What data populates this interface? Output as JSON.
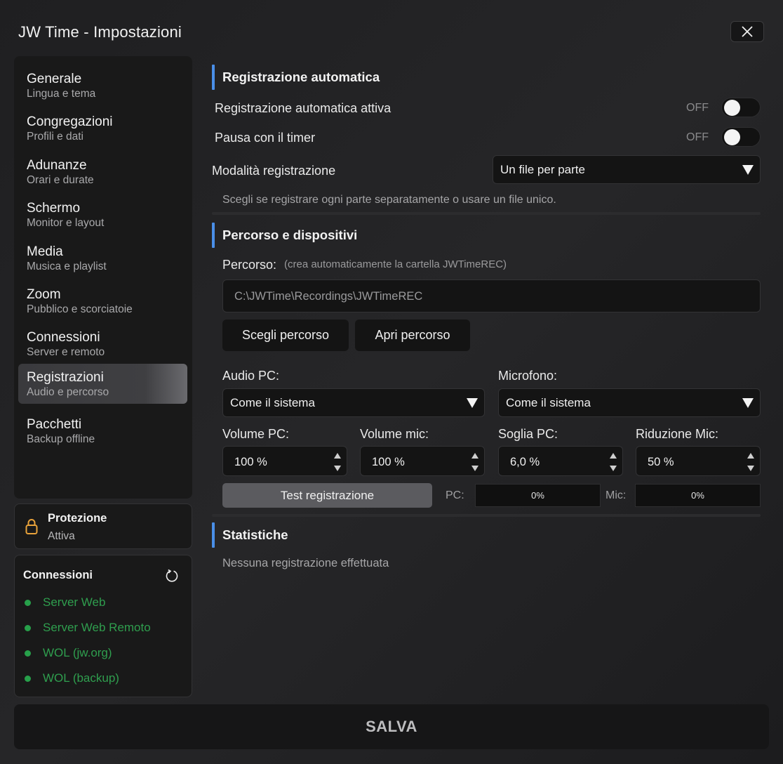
{
  "window": {
    "title": "JW Time - Impostazioni",
    "close_icon": "close-icon"
  },
  "sidebar": {
    "items": [
      {
        "title": "Generale",
        "subtitle": "Lingua e tema"
      },
      {
        "title": "Congregazioni",
        "subtitle": "Profili e dati"
      },
      {
        "title": "Adunanze",
        "subtitle": "Orari e durate"
      },
      {
        "title": "Schermo",
        "subtitle": "Monitor e layout"
      },
      {
        "title": "Media",
        "subtitle": "Musica e playlist"
      },
      {
        "title": "Zoom",
        "subtitle": "Pubblico e scorciatoie"
      },
      {
        "title": "Connessioni",
        "subtitle": "Server e remoto"
      },
      {
        "title": "Registrazioni",
        "subtitle": "Audio e percorso",
        "active": true
      },
      {
        "title": "Pacchetti",
        "subtitle": "Backup offline"
      }
    ]
  },
  "protection": {
    "title": "Protezione",
    "status": "Attiva",
    "icon": "lock-icon",
    "icon_color": "#e8a23a"
  },
  "connections": {
    "title": "Connessioni",
    "refresh_icon": "refresh-icon",
    "status_color": "#27a04a",
    "items": [
      "Server Web",
      "Server Web Remoto",
      "WOL (jw.org)",
      "WOL (backup)"
    ]
  },
  "auto_recording": {
    "section_title": "Registrazione automatica",
    "auto_active_label": "Registrazione automatica attiva",
    "auto_active_state": "OFF",
    "pause_timer_label": "Pausa con il timer",
    "pause_timer_state": "OFF",
    "mode_label": "Modalità registrazione",
    "mode_value": "Un file per parte",
    "mode_hint": "Scegli se registrare ogni parte separatamente o usare un file unico."
  },
  "path_devices": {
    "section_title": "Percorso e dispositivi",
    "path_label": "Percorso:",
    "path_hint": "(crea automaticamente la cartella JWTimeREC)",
    "path_value": "C:\\JWTime\\Recordings\\JWTimeREC",
    "choose_path": "Scegli percorso",
    "open_path": "Apri percorso",
    "audio_pc_label": "Audio PC:",
    "audio_pc_value": "Come il sistema",
    "mic_label": "Microfono:",
    "mic_value": "Come il sistema",
    "volume_pc_label": "Volume PC:",
    "volume_pc_value": "100 %",
    "volume_mic_label": "Volume mic:",
    "volume_mic_value": "100 %",
    "threshold_pc_label": "Soglia PC:",
    "threshold_pc_value": "6,0 %",
    "mic_reduction_label": "Riduzione Mic:",
    "mic_reduction_value": "50 %",
    "test_button": "Test registrazione",
    "pc_meter_label": "PC:",
    "pc_meter_value": "0%",
    "mic_meter_label": "Mic:",
    "mic_meter_value": "0%"
  },
  "stats": {
    "section_title": "Statistiche",
    "empty_text": "Nessuna registrazione effettuata"
  },
  "save_button": "SALVA",
  "accent_color": "#4a8fe8"
}
